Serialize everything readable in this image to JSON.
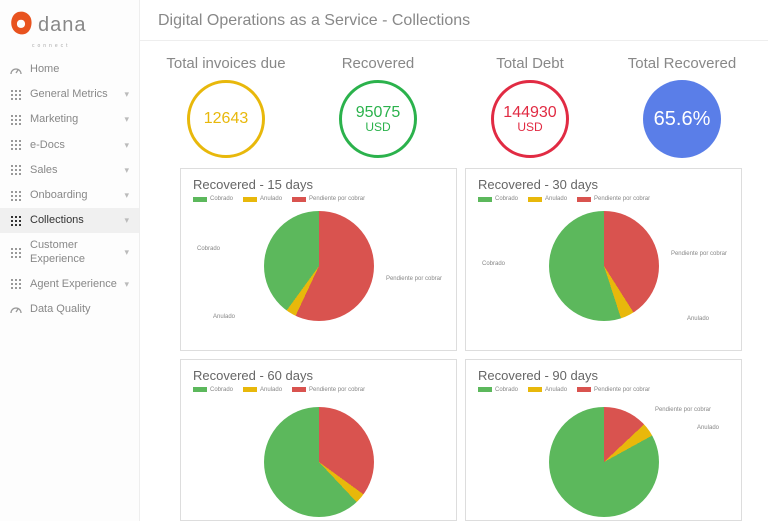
{
  "logo": {
    "text": "dana",
    "sub": "connect"
  },
  "nav": [
    {
      "label": "Home",
      "icon": "gauge",
      "expand": false
    },
    {
      "label": "General Metrics",
      "icon": "grid",
      "expand": true
    },
    {
      "label": "Marketing",
      "icon": "grid",
      "expand": true
    },
    {
      "label": "e-Docs",
      "icon": "grid",
      "expand": true
    },
    {
      "label": "Sales",
      "icon": "grid",
      "expand": true
    },
    {
      "label": "Onboarding",
      "icon": "grid",
      "expand": true
    },
    {
      "label": "Collections",
      "icon": "grid",
      "expand": true,
      "active": true
    },
    {
      "label": "Customer Experience",
      "icon": "grid",
      "expand": true
    },
    {
      "label": "Agent Experience",
      "icon": "grid",
      "expand": true
    },
    {
      "label": "Data Quality",
      "icon": "gauge",
      "expand": false
    }
  ],
  "header": {
    "title": "Digital Operations as a Service - Collections"
  },
  "metrics": {
    "invoices": {
      "title": "Total invoices due",
      "value": "12643"
    },
    "recovered": {
      "title": "Recovered",
      "value": "95075",
      "unit": "USD"
    },
    "debt": {
      "title": "Total Debt",
      "value": "144930",
      "unit": "USD"
    },
    "pct": {
      "title": "Total Recovered",
      "value": "65.6%"
    }
  },
  "legend": {
    "cobrado": "Cobrado",
    "anulado": "Anulado",
    "pendiente": "Pendiente por cobrar"
  },
  "pielabels": {
    "cobrado": "Cobrado",
    "anulado": "Anulado",
    "pendiente": "Pendiente por cobrar"
  },
  "charts": [
    {
      "title": "Recovered - 15 days"
    },
    {
      "title": "Recovered - 30 days"
    },
    {
      "title": "Recovered - 60 days"
    },
    {
      "title": "Recovered - 90 days"
    }
  ],
  "chart_data": [
    {
      "type": "pie",
      "title": "Recovered - 15 days",
      "series": [
        {
          "name": "Cobrado",
          "value": 40,
          "color": "#5cb85c"
        },
        {
          "name": "Anulado",
          "value": 3,
          "color": "#e8b80b"
        },
        {
          "name": "Pendiente por cobrar",
          "value": 57,
          "color": "#d9534f"
        }
      ]
    },
    {
      "type": "pie",
      "title": "Recovered - 30 days",
      "series": [
        {
          "name": "Cobrado",
          "value": 55,
          "color": "#5cb85c"
        },
        {
          "name": "Anulado",
          "value": 4,
          "color": "#e8b80b"
        },
        {
          "name": "Pendiente por cobrar",
          "value": 41,
          "color": "#d9534f"
        }
      ]
    },
    {
      "type": "pie",
      "title": "Recovered - 60 days",
      "series": [
        {
          "name": "Cobrado",
          "value": 62,
          "color": "#5cb85c"
        },
        {
          "name": "Anulado",
          "value": 3,
          "color": "#e8b80b"
        },
        {
          "name": "Pendiente por cobrar",
          "value": 35,
          "color": "#d9534f"
        }
      ]
    },
    {
      "type": "pie",
      "title": "Recovered - 90 days",
      "series": [
        {
          "name": "Cobrado",
          "value": 83,
          "color": "#5cb85c"
        },
        {
          "name": "Anulado",
          "value": 4,
          "color": "#e8b80b"
        },
        {
          "name": "Pendiente por cobrar",
          "value": 13,
          "color": "#d9534f"
        }
      ]
    }
  ]
}
